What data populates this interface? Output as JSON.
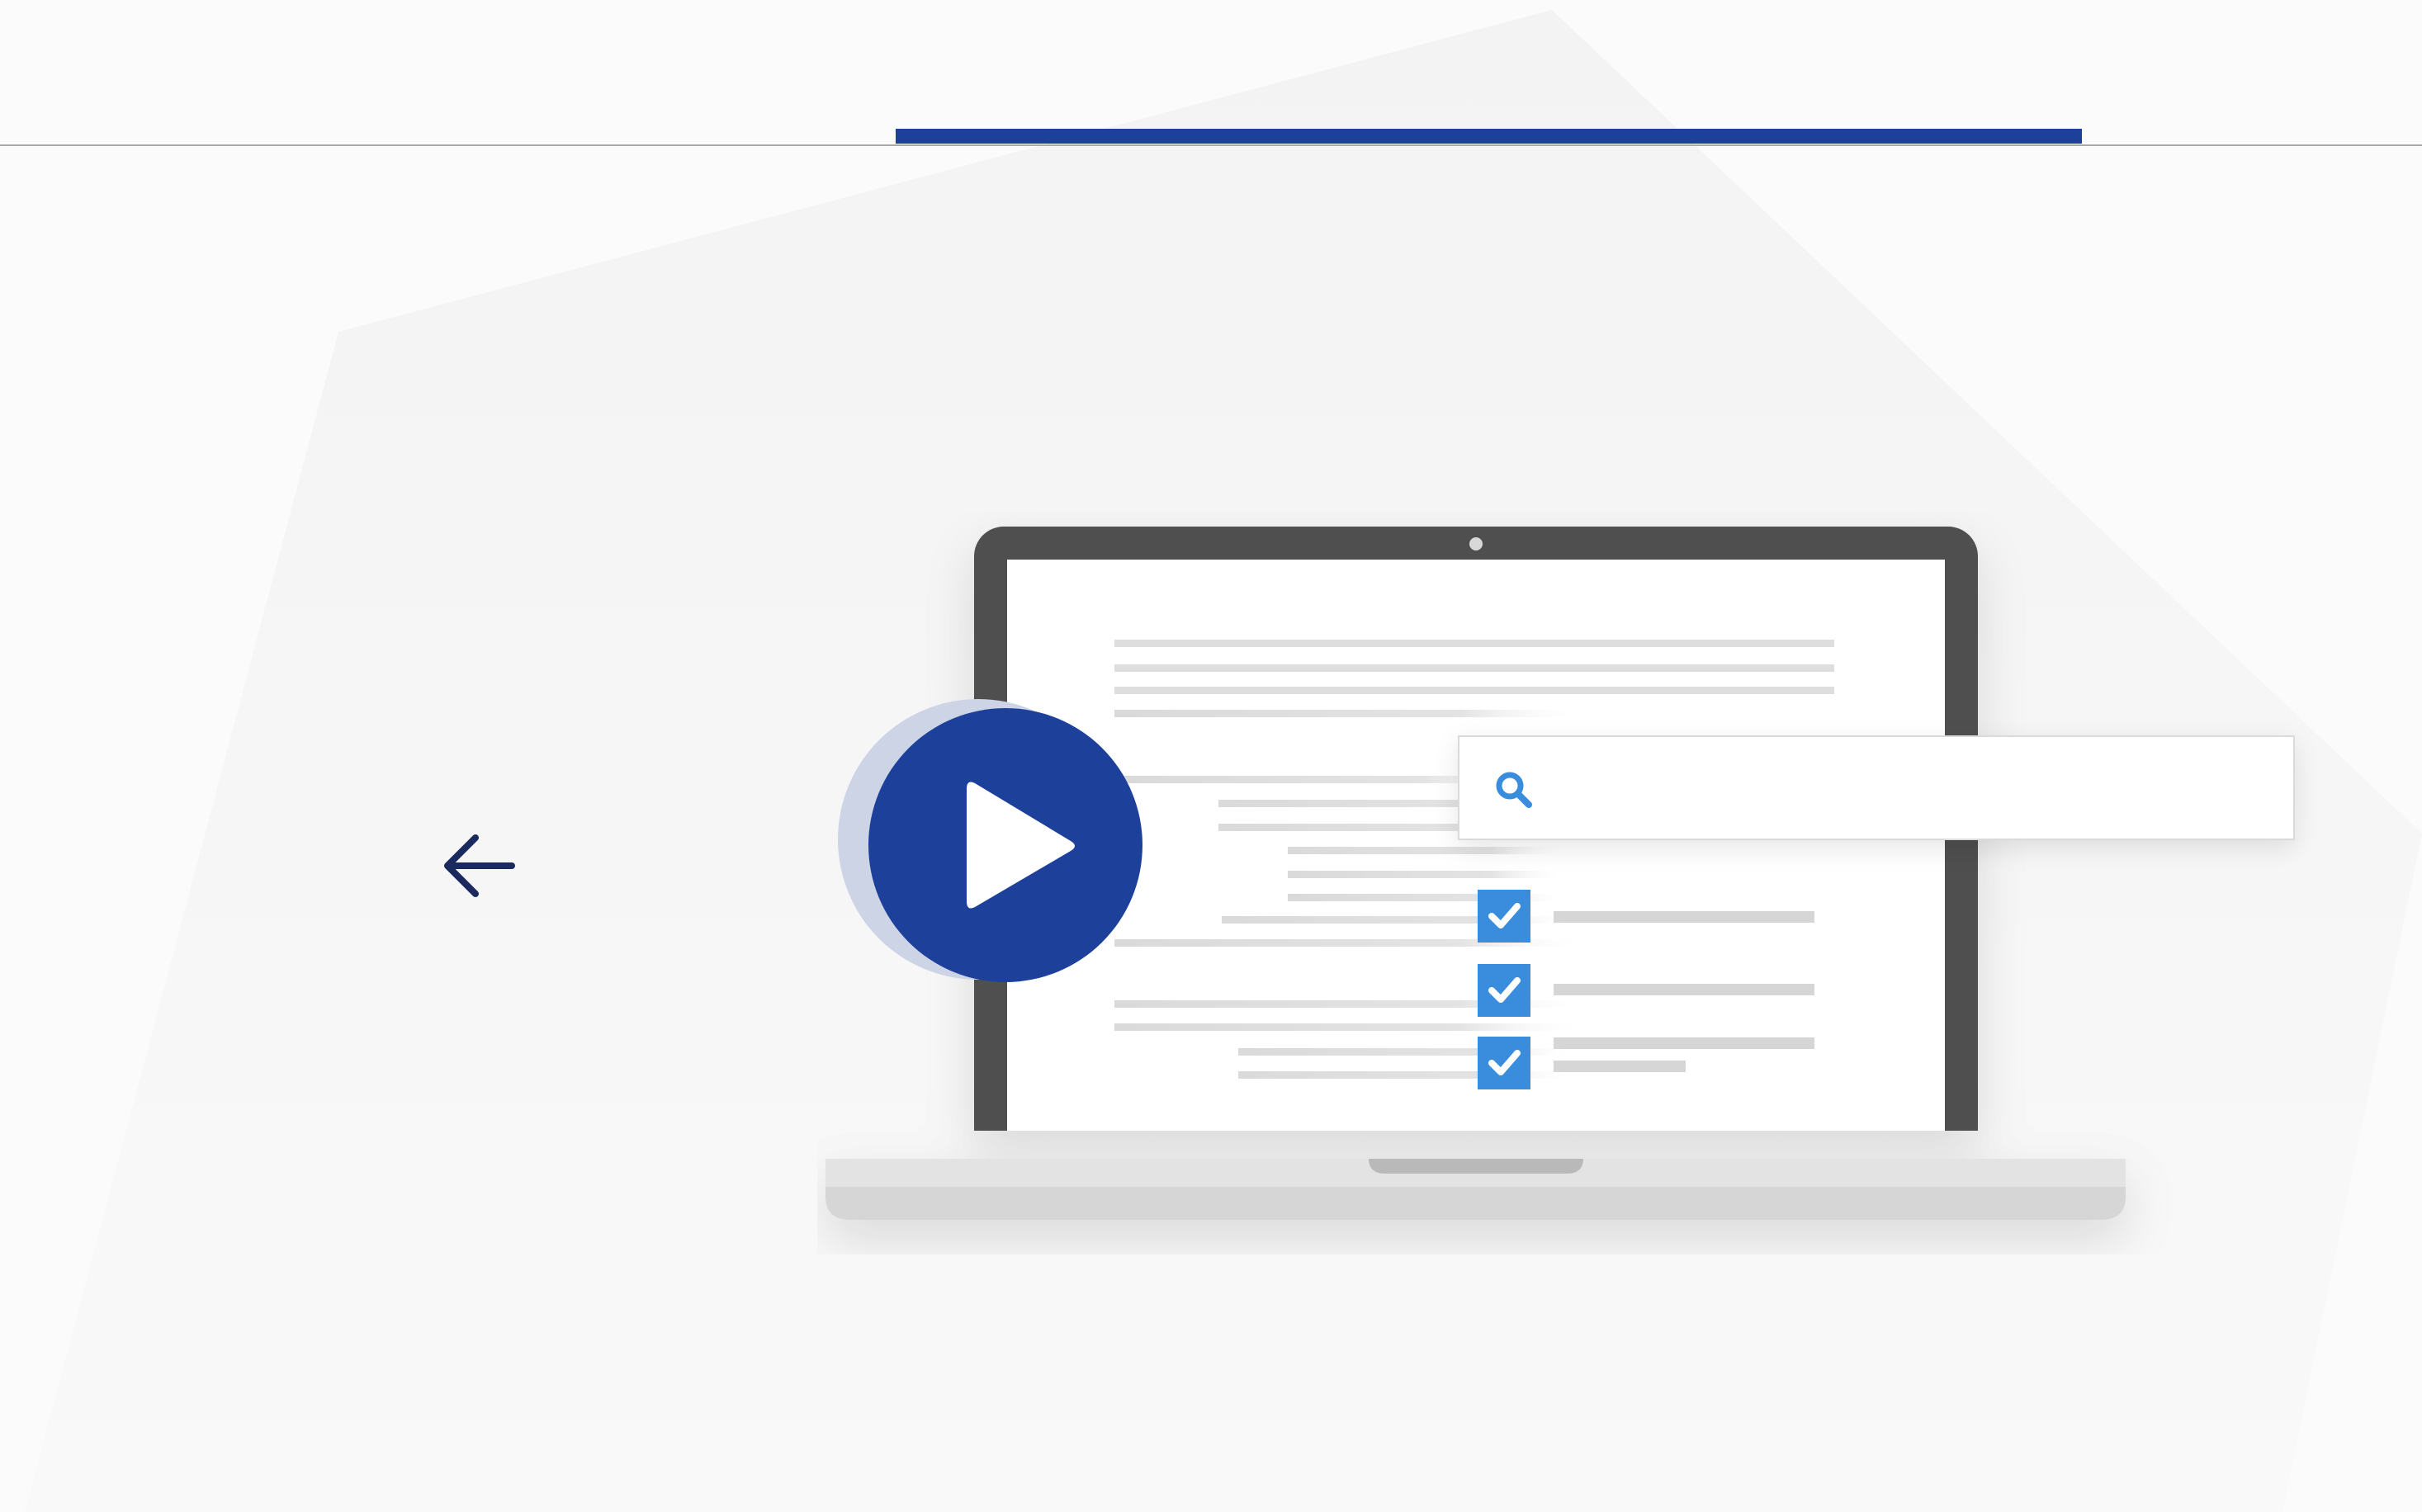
{
  "progress": {
    "fraction": 1.0
  },
  "navigation": {
    "back_icon": "arrow-left-icon"
  },
  "illustration": {
    "device_icon": "laptop-icon",
    "play_icon": "play-icon",
    "search_icon": "search-icon",
    "checkbox_icon": "checkbox-checked-icon",
    "checked_items": 3
  },
  "colors": {
    "brand_blue": "#1d419a",
    "play_halo": "#cdd4e6",
    "check_blue": "#3a8ddd",
    "laptop_frame": "#505050",
    "laptop_base": "#dcdcdc",
    "line_gray": "#dddddd",
    "rule_gray": "#a7a9ad"
  }
}
